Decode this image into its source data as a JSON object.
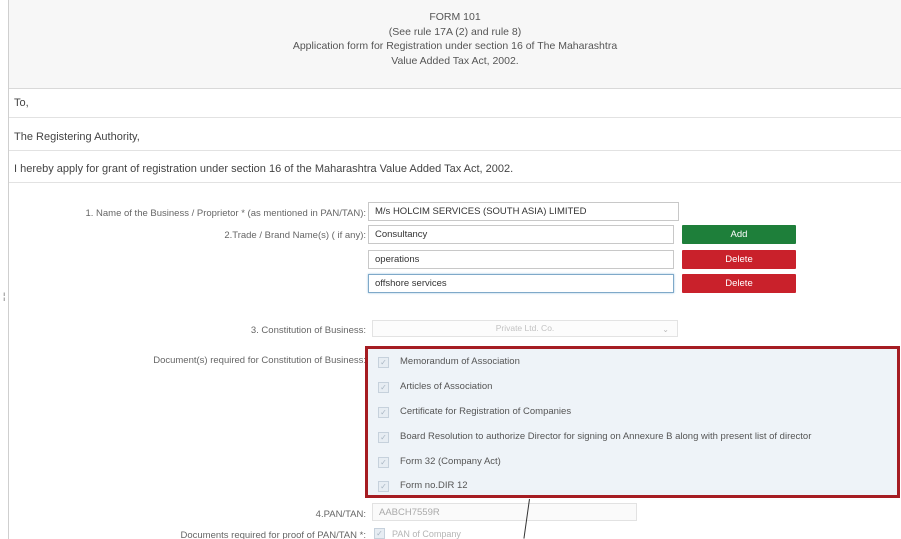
{
  "header": {
    "form_no": "FORM 101",
    "rule_ref": "(See rule 17A (2) and rule 8)",
    "title_line1": "Application form for Registration under section 16 of The Maharashtra",
    "title_line2": "Value Added Tax Act, 2002."
  },
  "intro": {
    "to": "To,",
    "authority": "The Registering Authority,",
    "request": "I hereby apply for grant of registration under section 16 of the Maharashtra Value Added Tax Act, 2002."
  },
  "fields": {
    "business_name_label": "1. Name of the Business / Proprietor * (as mentioned in PAN/TAN):",
    "business_name_value": "M/s HOLCIM SERVICES (SOUTH ASIA) LIMITED",
    "trade_name_label": "2.Trade / Brand Name(s) ( if any):",
    "trade_names": [
      "Consultancy",
      "operations",
      "offshore services"
    ],
    "add_label": "Add",
    "delete_label": "Delete",
    "constitution_label": "3. Constitution of Business:",
    "constitution_value": "Private Ltd. Co.",
    "docs_label": "Document(s) required for Constitution of Business:",
    "docs": [
      "Memorandum of Association",
      "Articles of Association",
      "Certificate for Registration of Companies",
      "Board Resolution to authorize Director for signing on Annexure B along with present list of director",
      "Form 32 (Company Act)",
      "Form no.DIR 12"
    ],
    "pan_label": "4.PAN/TAN:",
    "pan_value": "AABCH7559R",
    "pan_docs_label": "Documents required for proof of PAN/TAN *:",
    "pan_docs_value": "PAN of Company"
  },
  "icons": {
    "checkbox": "check-icon",
    "dropdown": "chevron-down-icon"
  },
  "colors": {
    "add": "#1e7f3a",
    "delete": "#c9212b",
    "highlight_border": "#a51c22"
  }
}
